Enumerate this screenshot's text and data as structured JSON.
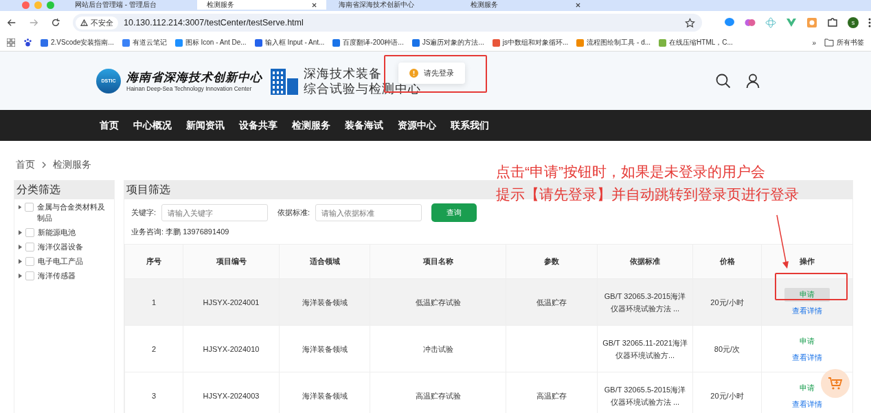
{
  "browser": {
    "tabs": [
      {
        "title": "网站后台管理端 - 管理后台",
        "selected": false
      },
      {
        "title": "检测服务",
        "selected": true
      },
      {
        "title": "海南省深海技术创新中心",
        "selected": false
      },
      {
        "title": "检测服务",
        "selected": false
      }
    ],
    "security": "不安全",
    "url": "10.130.112.214:3007/testCenter/testServe.html",
    "profile": "s",
    "bookmarks": [
      "2.VScode安装指南...",
      "有道云笔记",
      "图标 Icon - Ant De...",
      "输入框 Input - Ant...",
      "百度翻译-200种语...",
      "JS遍历对象的方法...",
      "js中数组和对象循环...",
      "流程图绘制工具 - d...",
      "在线压缩HTML，C..."
    ],
    "more": "»",
    "all_bookmarks": "所有书签"
  },
  "header": {
    "org_cn": "海南省深海技术创新中心",
    "org_en": "Hainan Deep-Sea Technology Innovation Center",
    "badge": "DSTIC",
    "title_line1": "深海技术装备",
    "title_line2": "综合试验与检测中心"
  },
  "toast": {
    "text": "请先登录"
  },
  "nav": [
    "首页",
    "中心概况",
    "新闻资讯",
    "设备共享",
    "检测服务",
    "装备海试",
    "资源中心",
    "联系我们"
  ],
  "breadcrumb": [
    "首页",
    "检测服务"
  ],
  "category": {
    "title": "分类筛选",
    "items": [
      {
        "label": "金属与合金类材料及制品",
        "checked": false
      },
      {
        "label": "新能源电池",
        "checked": false
      },
      {
        "label": "海洋仪器设备",
        "checked": false
      },
      {
        "label": "电子电工产品",
        "checked": false
      },
      {
        "label": "海洋传感器",
        "checked": false
      }
    ]
  },
  "filter": {
    "title": "项目筛选",
    "keyword_label": "关键字:",
    "keyword_placeholder": "请输入关键字",
    "standard_label": "依据标准:",
    "standard_placeholder": "请输入依据标准",
    "search_button": "查询",
    "consult": "业务咨询: 李鹏 13976891409"
  },
  "table": {
    "columns": [
      "序号",
      "项目编号",
      "适合领域",
      "项目名称",
      "参数",
      "依据标准",
      "价格",
      "操作"
    ],
    "rows": [
      {
        "cells": [
          "1",
          "HJSYX-2024001",
          "海洋装备领域",
          "低温贮存试验",
          "低温贮存",
          "GB/T 32065.3-2015海洋仪器环境试验方法 ...",
          "20元/小时"
        ],
        "apply": "申请",
        "details": "查看详情",
        "highlighted": true
      },
      {
        "cells": [
          "2",
          "HJSYX-2024010",
          "海洋装备领域",
          "冲击试验",
          "",
          "GB/T 32065.11-2021海洋仪器环境试验方...",
          "80元/次"
        ],
        "apply": "申请",
        "details": "查看详情",
        "highlighted": false
      },
      {
        "cells": [
          "3",
          "HJSYX-2024003",
          "海洋装备领域",
          "高温贮存试验",
          "高温贮存",
          "GB/T 32065.5-2015海洋仪器环境试验方法 ...",
          "20元/小时"
        ],
        "apply": "申请",
        "details": "查看详情",
        "highlighted": false
      }
    ]
  },
  "annotation": {
    "line1": "点击“申请”按钮时，如果是未登录的用户会",
    "line2": "提示【请先登录】并自动跳转到登录页进行登录"
  }
}
